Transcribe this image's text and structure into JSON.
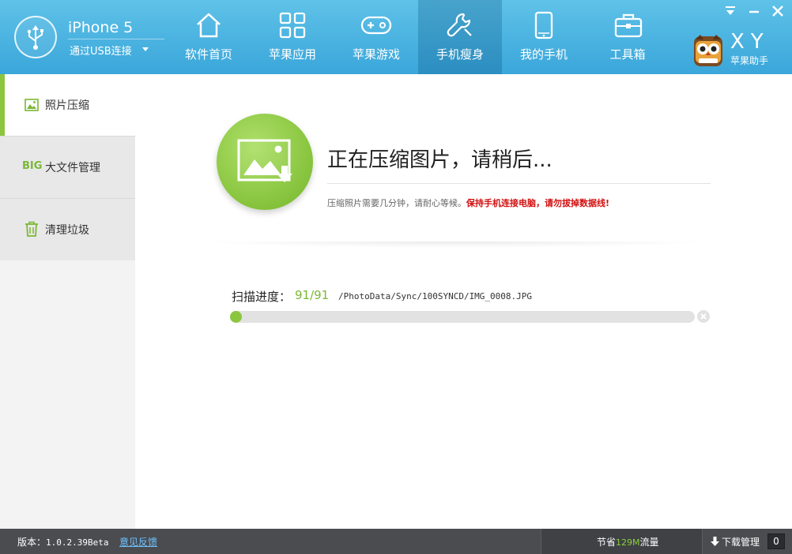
{
  "header": {
    "device_name": "iPhone 5",
    "connection": "通过USB连接",
    "nav": [
      {
        "label": "软件首页",
        "icon": "home-icon"
      },
      {
        "label": "苹果应用",
        "icon": "apps-grid-icon"
      },
      {
        "label": "苹果游戏",
        "icon": "gamepad-icon"
      },
      {
        "label": "手机瘦身",
        "icon": "wrench-icon"
      },
      {
        "label": "我的手机",
        "icon": "phone-icon"
      },
      {
        "label": "工具箱",
        "icon": "toolbox-icon"
      }
    ],
    "active_nav": "手机瘦身",
    "logo_text": "XY",
    "logo_sub": "苹果助手"
  },
  "sidebar": {
    "items": [
      {
        "label": "照片压缩",
        "icon": "photo-icon",
        "active": true
      },
      {
        "label": "大文件管理",
        "icon": "big-tag",
        "tag": "BIG"
      },
      {
        "label": "清理垃圾",
        "icon": "trash-icon"
      }
    ]
  },
  "main": {
    "status_title": "正在压缩图片，请稍后...",
    "hint": "压缩照片需要几分钟，请耐心等候。",
    "warning": "保持手机连接电脑，请勿拔掉数据线!",
    "scan_label": "扫描进度：",
    "scan_count": "91/91",
    "scan_path": "/PhotoData/Sync/100SYNCD/IMG_0008.JPG",
    "progress": 0.02
  },
  "footer": {
    "version_label": "版本：",
    "version": "1.0.2.39Beta",
    "feedback": "意见反馈",
    "save_prefix": "节省",
    "save_amount": "129M",
    "save_suffix": "流量",
    "download_label": "下载管理",
    "download_count": "0"
  },
  "colors": {
    "header_top": "#5fc2e8",
    "header_bottom": "#3aa6da",
    "accent_green": "#8cc63f",
    "warning_red": "#d21010",
    "footer_bg": "#4a4c50"
  }
}
